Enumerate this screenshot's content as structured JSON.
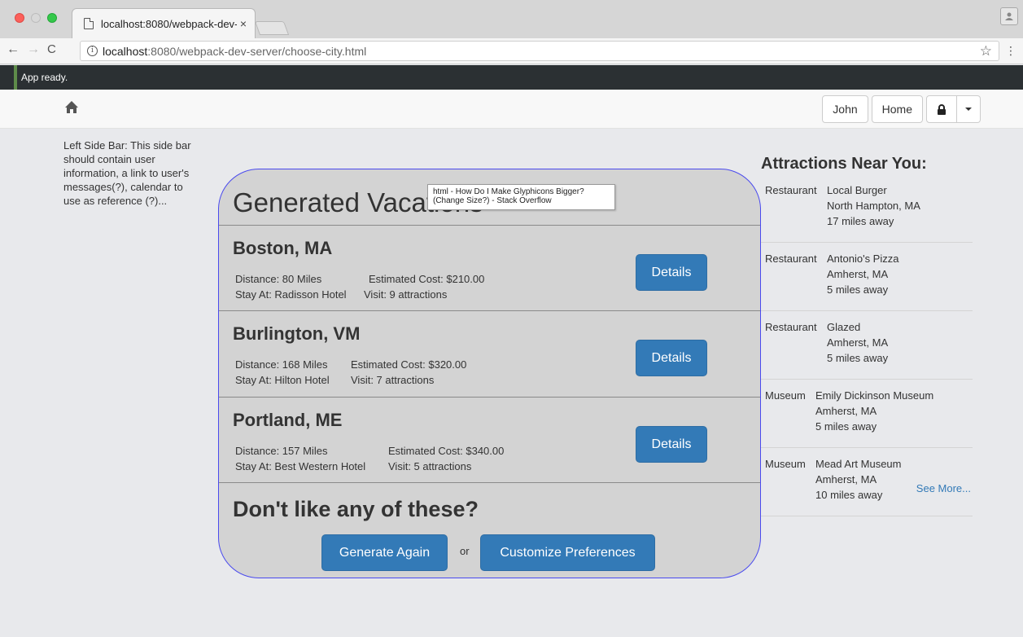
{
  "browser": {
    "tab_title": "localhost:8080/webpack-dev-",
    "tab_close": "×",
    "url_host": "localhost",
    "url_path": ":8080/webpack-dev-server/choose-city.html",
    "info_glyph": "i",
    "star_glyph": "☆",
    "menu_glyph": "⋮",
    "back_glyph": "←",
    "forward_glyph": "→",
    "reload_glyph": "C"
  },
  "status_bar": {
    "text": "App ready."
  },
  "navbar": {
    "user_label": "John",
    "home_label": "Home"
  },
  "left_sidebar": {
    "text": "Left Side Bar: This side bar should contain user information, a link to user's messages(?), calendar to use as reference (?)..."
  },
  "main": {
    "title": "Generated Vacations",
    "tooltip": "html - How Do I Make Glyphicons Bigger? (Change Size?) - Stack Overflow",
    "vacations": [
      {
        "city": "Boston, MA",
        "distance": "Distance: 80 Miles",
        "cost": "Estimated Cost: $210.00",
        "stay": "Stay At: Radisson Hotel",
        "visit": "Visit: 9 attractions",
        "details_label": "Details"
      },
      {
        "city": "Burlington, VM",
        "distance": "Distance: 168 Miles",
        "cost": "Estimated Cost: $320.00",
        "stay": "Stay At: Hilton Hotel",
        "visit": "Visit: 7 attractions",
        "details_label": "Details"
      },
      {
        "city": "Portland, ME",
        "distance": "Distance: 157 Miles",
        "cost": "Estimated Cost: $340.00",
        "stay": "Stay At: Best Western Hotel",
        "visit": "Visit: 5 attractions",
        "details_label": "Details"
      }
    ],
    "dislike_title": "Don't like any of these?",
    "generate_label": "Generate Again",
    "or_label": "or",
    "customize_label": "Customize Preferences"
  },
  "attractions": {
    "title": "Attractions Near You:",
    "items": [
      {
        "type": "Restaurant",
        "name": "Local Burger",
        "location": "North Hampton, MA",
        "distance": "17 miles away"
      },
      {
        "type": "Restaurant",
        "name": "Antonio's Pizza",
        "location": "Amherst, MA",
        "distance": "5 miles away"
      },
      {
        "type": "Restaurant",
        "name": "Glazed",
        "location": "Amherst, MA",
        "distance": "5 miles away"
      },
      {
        "type": "Museum",
        "name": "Emily Dickinson Museum",
        "location": "Amherst, MA",
        "distance": "5 miles away"
      },
      {
        "type": "Museum",
        "name": "Mead Art Museum",
        "location": "Amherst, MA",
        "distance": "10 miles away"
      }
    ],
    "see_more": "See More..."
  },
  "colors": {
    "primary": "#337ab7",
    "card_border": "#4a4aee",
    "status_bar": "#2b3033"
  }
}
